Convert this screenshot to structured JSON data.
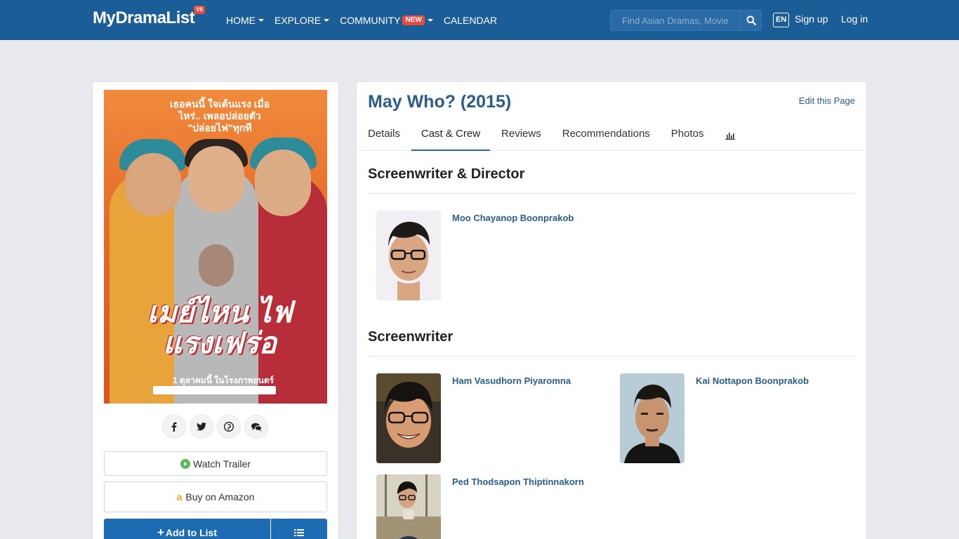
{
  "nav": {
    "logo": "MyDramaList",
    "logo_badge": "V6",
    "items": [
      {
        "label": "HOME",
        "dropdown": true
      },
      {
        "label": "EXPLORE",
        "dropdown": true
      },
      {
        "label": "COMMUNITY",
        "dropdown": true,
        "badge": "NEW"
      },
      {
        "label": "CALENDAR",
        "dropdown": false
      }
    ],
    "search_placeholder": "Find Asian Dramas, Movies, Actors and more...",
    "lang": "EN",
    "signup": "Sign up",
    "login": "Log in"
  },
  "poster": {
    "tagline": "เธอคนนี้ ใจเต้นแรง เมื่อไหร่.. เพลอปล่อยตัว \"ปล่อยไฟ\"ทุกที",
    "title": "เมย์ไหน ไฟแรงเฟร่อ",
    "release": "1 ตุลาคมนี้ ในโรงภาพยนตร์"
  },
  "actions": {
    "watch_trailer": "Watch Trailer",
    "buy_amazon": "Buy on Amazon",
    "add_to_list": "Add to List"
  },
  "main": {
    "title": "May Who? (2015)",
    "edit_link": "Edit this Page",
    "tabs": [
      "Details",
      "Cast & Crew",
      "Reviews",
      "Recommendations",
      "Photos"
    ],
    "active_tab": "Cast & Crew",
    "sections": [
      {
        "title": "Screenwriter & Director",
        "people": [
          {
            "name": "Moo Chayanop Boonprakob"
          }
        ]
      },
      {
        "title": "Screenwriter",
        "people": [
          {
            "name": "Ham Vasudhorn Piyaromna"
          },
          {
            "name": "Kai Nottapon Boonprakob"
          },
          {
            "name": "Ped Thodsapon Thiptinnakorn"
          }
        ]
      }
    ]
  },
  "colors": {
    "navbar": "#1b5d96",
    "link": "#2a5d8a",
    "primary_button": "#1c6bb3",
    "badge": "#e84b3c"
  }
}
